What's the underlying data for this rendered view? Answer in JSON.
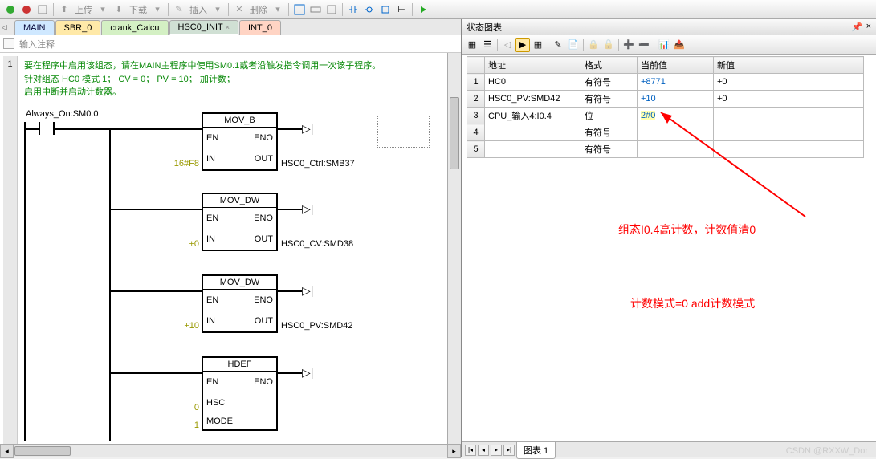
{
  "toolbar": {
    "upload_label": "上传",
    "download_label": "下载",
    "insert_label": "插入",
    "delete_label": "删除"
  },
  "tabs": {
    "main": "MAIN",
    "sbr": "SBR_0",
    "crank": "crank_Calcu",
    "hsc": "HSC0_INIT",
    "int": "INT_0"
  },
  "comment_placeholder": "输入注释",
  "network": {
    "num": "1",
    "desc_line1": "要在程序中启用该组态，请在MAIN主程序中使用SM0.1或者沿触发指令调用一次该子程序。",
    "desc_line2": "针对组态 HC0 模式 1；   CV = 0；   PV = 10；   加计数；",
    "desc_line3": "启用中断并启动计数器。",
    "contact": "Always_On:SM0.0"
  },
  "blocks": {
    "mov_b": {
      "title": "MOV_B",
      "en": "EN",
      "eno": "ENO",
      "in": "IN",
      "out": "OUT",
      "in_val": "16#F8",
      "out_val": "HSC0_Ctrl:SMB37"
    },
    "mov_dw1": {
      "title": "MOV_DW",
      "en": "EN",
      "eno": "ENO",
      "in": "IN",
      "out": "OUT",
      "in_val": "+0",
      "out_val": "HSC0_CV:SMD38"
    },
    "mov_dw2": {
      "title": "MOV_DW",
      "en": "EN",
      "eno": "ENO",
      "in": "IN",
      "out": "OUT",
      "in_val": "+10",
      "out_val": "HSC0_PV:SMD42"
    },
    "hdef": {
      "title": "HDEF",
      "en": "EN",
      "eno": "ENO",
      "hsc": "HSC",
      "mode": "MODE",
      "hsc_val": "0",
      "mode_val": "1"
    }
  },
  "right_panel": {
    "title": "状态图表",
    "headers": {
      "addr": "地址",
      "format": "格式",
      "current": "当前值",
      "new": "新值"
    },
    "rows": [
      {
        "n": "1",
        "addr": "HC0",
        "fmt": "有符号",
        "cur": "+8771",
        "nv": "+0"
      },
      {
        "n": "2",
        "addr": "HSC0_PV:SMD42",
        "fmt": "有符号",
        "cur": "+10",
        "nv": "+0"
      },
      {
        "n": "3",
        "addr": "CPU_输入4:I0.4",
        "fmt": "位",
        "cur": "2#0",
        "nv": ""
      },
      {
        "n": "4",
        "addr": "",
        "fmt": "有符号",
        "cur": "",
        "nv": ""
      },
      {
        "n": "5",
        "addr": "",
        "fmt": "有符号",
        "cur": "",
        "nv": ""
      }
    ],
    "annot1": "组态I0.4高计数，计数值清0",
    "annot2": "计数模式=0   add计数模式",
    "bottom_tab": "图表 1"
  },
  "watermark": "CSDN @RXXW_Dor"
}
